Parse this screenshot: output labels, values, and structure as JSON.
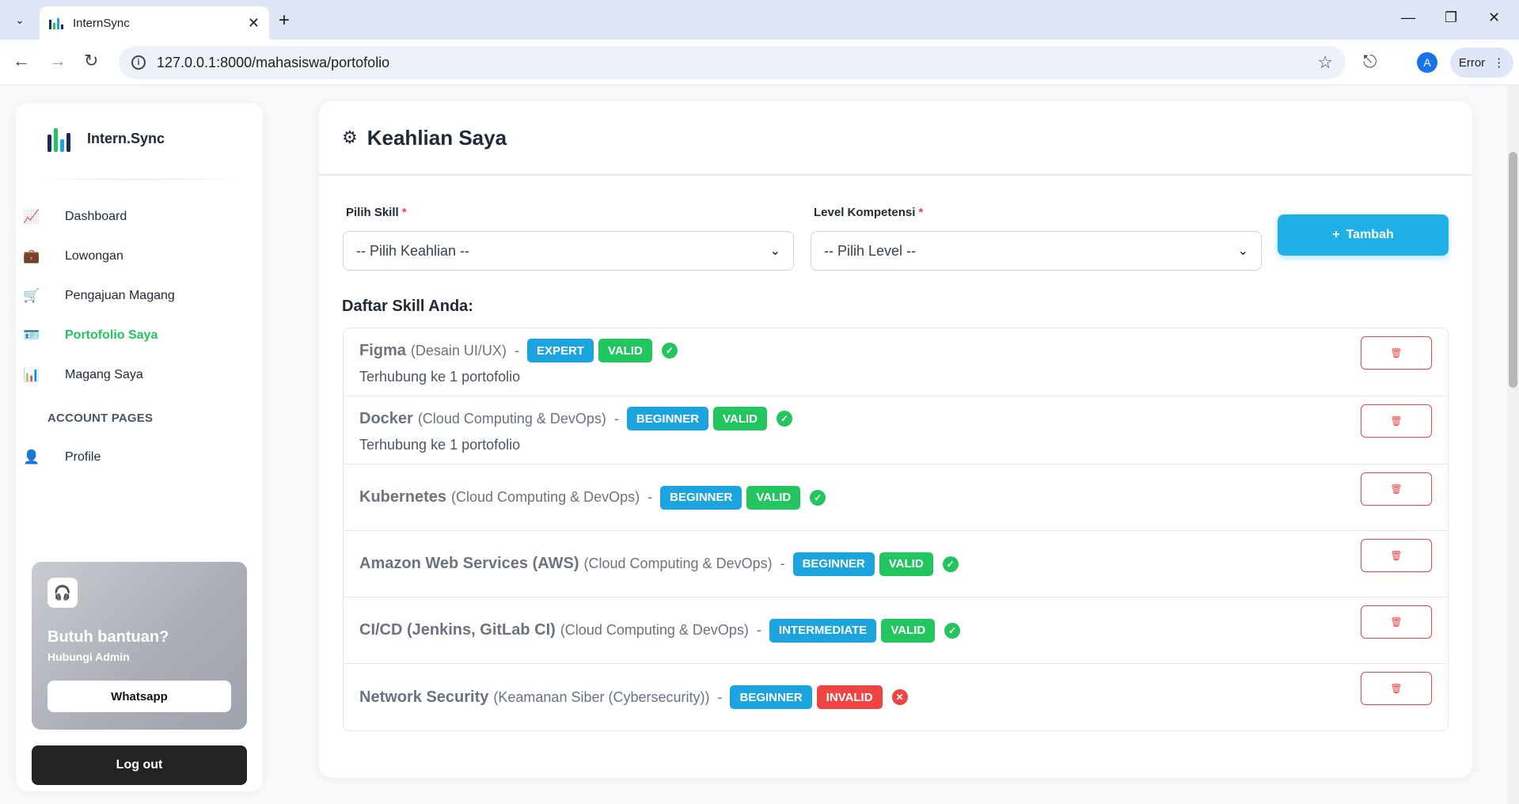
{
  "browser": {
    "tab_title": "InternSync",
    "url": "127.0.0.1:8000/mahasiswa/portofolio",
    "avatar_letter": "A",
    "profile_status": "Error"
  },
  "sidebar": {
    "brand": "Intern.Sync",
    "items": [
      {
        "label": "Dashboard",
        "icon": "chart-line-icon"
      },
      {
        "label": "Lowongan",
        "icon": "briefcase-icon"
      },
      {
        "label": "Pengajuan Magang",
        "icon": "cart-icon"
      },
      {
        "label": "Portofolio Saya",
        "icon": "id-card-icon",
        "active": true
      },
      {
        "label": "Magang Saya",
        "icon": "bar-chart-icon"
      }
    ],
    "section_title": "ACCOUNT PAGES",
    "account_items": [
      {
        "label": "Profile",
        "icon": "user-icon"
      }
    ],
    "help": {
      "title": "Butuh bantuan?",
      "subtitle": "Hubungi Admin",
      "button": "Whatsapp"
    },
    "logout": "Log out"
  },
  "main": {
    "title": "Keahlian Saya",
    "form": {
      "skill_label": "Pilih Skill",
      "skill_placeholder": "-- Pilih Keahlian --",
      "level_label": "Level Kompetensi",
      "level_placeholder": "-- Pilih Level --",
      "required_mark": "*",
      "add_button": "Tambah"
    },
    "list_title": "Daftar Skill Anda:",
    "skills": [
      {
        "name": "Figma",
        "category": "(Desain UI/UX)",
        "level": "EXPERT",
        "status": "VALID",
        "valid": true,
        "note": "Terhubung ke 1 portofolio"
      },
      {
        "name": "Docker",
        "category": "(Cloud Computing & DevOps)",
        "level": "BEGINNER",
        "status": "VALID",
        "valid": true,
        "note": "Terhubung ke 1 portofolio"
      },
      {
        "name": "Kubernetes",
        "category": "(Cloud Computing & DevOps)",
        "level": "BEGINNER",
        "status": "VALID",
        "valid": true,
        "note": ""
      },
      {
        "name": "Amazon Web Services (AWS)",
        "category": "(Cloud Computing & DevOps)",
        "level": "BEGINNER",
        "status": "VALID",
        "valid": true,
        "note": ""
      },
      {
        "name": "CI/CD (Jenkins, GitLab CI)",
        "category": "(Cloud Computing & DevOps)",
        "level": "INTERMEDIATE",
        "status": "VALID",
        "valid": true,
        "note": ""
      },
      {
        "name": "Network Security",
        "category": "(Keamanan Siber (Cybersecurity))",
        "level": "BEGINNER",
        "status": "INVALID",
        "valid": false,
        "note": ""
      }
    ]
  },
  "colors": {
    "accent": "#1fb0e8",
    "valid": "#22c55e",
    "invalid": "#ef4444",
    "level_badge": "#1ca4df"
  }
}
